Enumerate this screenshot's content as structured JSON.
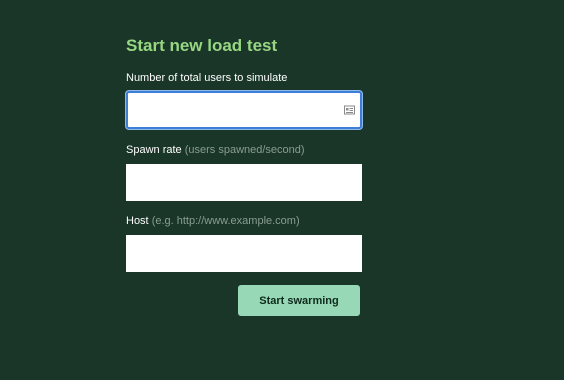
{
  "form": {
    "title": "Start new load test",
    "users_field": {
      "label": "Number of total users to simulate",
      "value": "",
      "placeholder": "",
      "icon": "contact-card-icon"
    },
    "spawn_rate_field": {
      "label": "Spawn rate",
      "hint": "(users spawned/second)",
      "value": "",
      "placeholder": ""
    },
    "host_field": {
      "label": "Host",
      "hint": "(e.g. http://www.example.com)",
      "value": "",
      "placeholder": ""
    },
    "submit_label": "Start swarming"
  },
  "colors": {
    "background": "#1a3629",
    "title": "#97d782",
    "hint": "#8a9d92",
    "button": "#97d9b6",
    "focus_ring": "#3d7fd6"
  }
}
